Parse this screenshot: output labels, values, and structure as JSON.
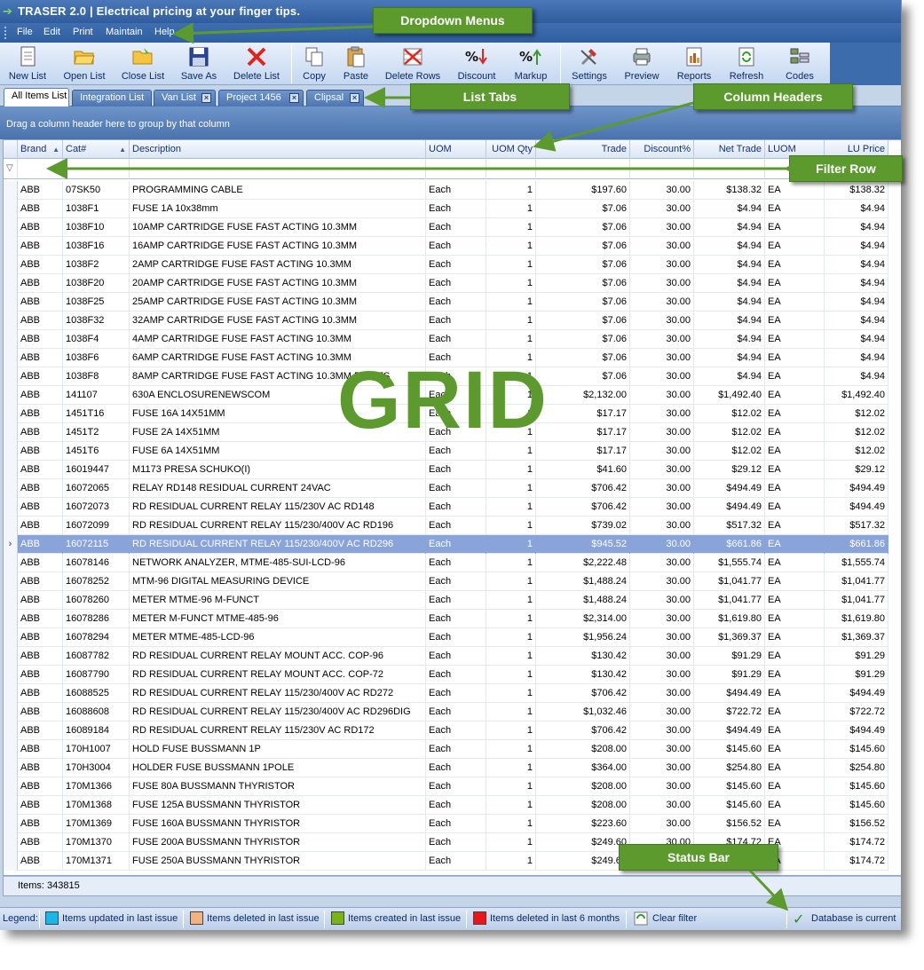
{
  "app": {
    "title": "TRASER 2.0 | Electrical pricing at your finger tips."
  },
  "menu": [
    "File",
    "Edit",
    "Print",
    "Maintain",
    "Help"
  ],
  "toolbar": [
    {
      "label": "New List",
      "icon": "new-list-icon"
    },
    {
      "label": "Open List",
      "icon": "folder-open-icon"
    },
    {
      "label": "Close List",
      "icon": "folder-close-icon"
    },
    {
      "label": "Save As",
      "icon": "floppy-disk-icon"
    },
    {
      "label": "Delete List",
      "icon": "red-x-icon"
    },
    {
      "label": "Copy",
      "icon": "copy-icon"
    },
    {
      "label": "Paste",
      "icon": "paste-icon"
    },
    {
      "label": "Delete Rows",
      "icon": "delete-rows-icon"
    },
    {
      "label": "Discount",
      "icon": "discount-icon"
    },
    {
      "label": "Markup",
      "icon": "markup-icon"
    },
    {
      "label": "Settings",
      "icon": "settings-icon"
    },
    {
      "label": "Preview",
      "icon": "preview-icon"
    },
    {
      "label": "Reports",
      "icon": "reports-icon"
    },
    {
      "label": "Refresh",
      "icon": "refresh-icon"
    },
    {
      "label": "Codes",
      "icon": "codes-icon"
    }
  ],
  "tabs": [
    "All Items List",
    "Integration List",
    "Van List",
    "Project 1456",
    "Clipsal"
  ],
  "group_panel_text": "Drag a column header here to group by that column",
  "columns": [
    "Brand",
    "Cat#",
    "Description",
    "UOM",
    "UOM Qty",
    "Trade",
    "Discount%",
    "Net Trade",
    "LUOM",
    "LU Price"
  ],
  "rows": [
    [
      "ABB",
      "07SK50",
      "PROGRAMMING CABLE",
      "Each",
      "1",
      "$197.60",
      "30.00",
      "$138.32",
      "EA",
      "$138.32"
    ],
    [
      "ABB",
      "1038F1",
      "FUSE 1A 10x38mm",
      "Each",
      "1",
      "$7.06",
      "30.00",
      "$4.94",
      "EA",
      "$4.94"
    ],
    [
      "ABB",
      "1038F10",
      "10AMP CARTRIDGE FUSE FAST ACTING 10.3MM",
      "Each",
      "1",
      "$7.06",
      "30.00",
      "$4.94",
      "EA",
      "$4.94"
    ],
    [
      "ABB",
      "1038F16",
      "16AMP CARTRIDGE FUSE FAST ACTING 10.3MM",
      "Each",
      "1",
      "$7.06",
      "30.00",
      "$4.94",
      "EA",
      "$4.94"
    ],
    [
      "ABB",
      "1038F2",
      "2AMP CARTRIDGE FUSE FAST ACTING 10.3MM",
      "Each",
      "1",
      "$7.06",
      "30.00",
      "$4.94",
      "EA",
      "$4.94"
    ],
    [
      "ABB",
      "1038F20",
      "20AMP CARTRIDGE FUSE FAST ACTING 10.3MM",
      "Each",
      "1",
      "$7.06",
      "30.00",
      "$4.94",
      "EA",
      "$4.94"
    ],
    [
      "ABB",
      "1038F25",
      "25AMP CARTRIDGE FUSE FAST ACTING 10.3MM",
      "Each",
      "1",
      "$7.06",
      "30.00",
      "$4.94",
      "EA",
      "$4.94"
    ],
    [
      "ABB",
      "1038F32",
      "32AMP CARTRIDGE FUSE FAST ACTING 10.3MM",
      "Each",
      "1",
      "$7.06",
      "30.00",
      "$4.94",
      "EA",
      "$4.94"
    ],
    [
      "ABB",
      "1038F4",
      "4AMP CARTRIDGE FUSE FAST ACTING 10.3MM",
      "Each",
      "1",
      "$7.06",
      "30.00",
      "$4.94",
      "EA",
      "$4.94"
    ],
    [
      "ABB",
      "1038F6",
      "6AMP CARTRIDGE FUSE FAST ACTING 10.3MM",
      "Each",
      "1",
      "$7.06",
      "30.00",
      "$4.94",
      "EA",
      "$4.94"
    ],
    [
      "ABB",
      "1038F8",
      "8AMP CARTRIDGE FUSE FAST ACTING 10.3MM FOR FS",
      "Each",
      "1",
      "$7.06",
      "30.00",
      "$4.94",
      "EA",
      "$4.94"
    ],
    [
      "ABB",
      "141107",
      "630A ENCLOSURENEWSCOM",
      "Each",
      "1",
      "$2,132.00",
      "30.00",
      "$1,492.40",
      "EA",
      "$1,492.40"
    ],
    [
      "ABB",
      "1451T16",
      "FUSE 16A 14X51MM",
      "Each",
      "1",
      "$17.17",
      "30.00",
      "$12.02",
      "EA",
      "$12.02"
    ],
    [
      "ABB",
      "1451T2",
      "FUSE 2A 14X51MM",
      "Each",
      "1",
      "$17.17",
      "30.00",
      "$12.02",
      "EA",
      "$12.02"
    ],
    [
      "ABB",
      "1451T6",
      "FUSE 6A 14X51MM",
      "Each",
      "1",
      "$17.17",
      "30.00",
      "$12.02",
      "EA",
      "$12.02"
    ],
    [
      "ABB",
      "16019447",
      "M1173 PRESA SCHUKO(I)",
      "Each",
      "1",
      "$41.60",
      "30.00",
      "$29.12",
      "EA",
      "$29.12"
    ],
    [
      "ABB",
      "16072065",
      "RELAY RD148 RESIDUAL CURRENT 24VAC",
      "Each",
      "1",
      "$706.42",
      "30.00",
      "$494.49",
      "EA",
      "$494.49"
    ],
    [
      "ABB",
      "16072073",
      "RD RESIDUAL CURRENT RELAY 115/230V AC RD148",
      "Each",
      "1",
      "$706.42",
      "30.00",
      "$494.49",
      "EA",
      "$494.49"
    ],
    [
      "ABB",
      "16072099",
      "RD RESIDUAL CURRENT RELAY 115/230/400V AC RD196",
      "Each",
      "1",
      "$739.02",
      "30.00",
      "$517.32",
      "EA",
      "$517.32"
    ],
    [
      "ABB",
      "16072115",
      "RD RESIDUAL CURRENT RELAY 115/230/400V AC RD296",
      "Each",
      "1",
      "$945.52",
      "30.00",
      "$661.86",
      "EA",
      "$661.86"
    ],
    [
      "ABB",
      "16078146",
      "NETWORK ANALYZER, MTME-485-SUI-LCD-96",
      "Each",
      "1",
      "$2,222.48",
      "30.00",
      "$1,555.74",
      "EA",
      "$1,555.74"
    ],
    [
      "ABB",
      "16078252",
      "MTM-96 DIGITAL MEASURING DEVICE",
      "Each",
      "1",
      "$1,488.24",
      "30.00",
      "$1,041.77",
      "EA",
      "$1,041.77"
    ],
    [
      "ABB",
      "16078260",
      "METER MTME-96 M-FUNCT",
      "Each",
      "1",
      "$1,488.24",
      "30.00",
      "$1,041.77",
      "EA",
      "$1,041.77"
    ],
    [
      "ABB",
      "16078286",
      "METER M-FUNCT MTME-485-96",
      "Each",
      "1",
      "$2,314.00",
      "30.00",
      "$1,619.80",
      "EA",
      "$1,619.80"
    ],
    [
      "ABB",
      "16078294",
      "METER MTME-485-LCD-96",
      "Each",
      "1",
      "$1,956.24",
      "30.00",
      "$1,369.37",
      "EA",
      "$1,369.37"
    ],
    [
      "ABB",
      "16087782",
      "RD RESIDUAL CURRENT RELAY MOUNT ACC. COP-96",
      "Each",
      "1",
      "$130.42",
      "30.00",
      "$91.29",
      "EA",
      "$91.29"
    ],
    [
      "ABB",
      "16087790",
      "RD RESIDUAL CURRENT RELAY MOUNT ACC. COP-72",
      "Each",
      "1",
      "$130.42",
      "30.00",
      "$91.29",
      "EA",
      "$91.29"
    ],
    [
      "ABB",
      "16088525",
      "RD RESIDUAL CURRENT RELAY 115/230/400V AC RD272",
      "Each",
      "1",
      "$706.42",
      "30.00",
      "$494.49",
      "EA",
      "$494.49"
    ],
    [
      "ABB",
      "16088608",
      "RD RESIDUAL CURRENT RELAY 115/230/400V AC RD296DIG",
      "Each",
      "1",
      "$1,032.46",
      "30.00",
      "$722.72",
      "EA",
      "$722.72"
    ],
    [
      "ABB",
      "16089184",
      "RD RESIDUAL CURRENT RELAY 115/230V AC RD172",
      "Each",
      "1",
      "$706.42",
      "30.00",
      "$494.49",
      "EA",
      "$494.49"
    ],
    [
      "ABB",
      "170H1007",
      "HOLD FUSE BUSSMANN 1P",
      "Each",
      "1",
      "$208.00",
      "30.00",
      "$145.60",
      "EA",
      "$145.60"
    ],
    [
      "ABB",
      "170H3004",
      "HOLDER FUSE BUSSMANN 1POLE",
      "Each",
      "1",
      "$364.00",
      "30.00",
      "$254.80",
      "EA",
      "$254.80"
    ],
    [
      "ABB",
      "170M1366",
      "FUSE 80A BUSSMANN THYRISTOR",
      "Each",
      "1",
      "$208.00",
      "30.00",
      "$145.60",
      "EA",
      "$145.60"
    ],
    [
      "ABB",
      "170M1368",
      "FUSE 125A BUSSMANN THYRISTOR",
      "Each",
      "1",
      "$208.00",
      "30.00",
      "$145.60",
      "EA",
      "$145.60"
    ],
    [
      "ABB",
      "170M1369",
      "FUSE 160A BUSSMANN THYRISTOR",
      "Each",
      "1",
      "$223.60",
      "30.00",
      "$156.52",
      "EA",
      "$156.52"
    ],
    [
      "ABB",
      "170M1370",
      "FUSE 200A BUSSMANN THYRISTOR",
      "Each",
      "1",
      "$249.60",
      "30.00",
      "$174.72",
      "EA",
      "$174.72"
    ],
    [
      "ABB",
      "170M1371",
      "FUSE 250A BUSSMANN THYRISTOR",
      "Each",
      "1",
      "$249.60",
      "30.00",
      "$174.72",
      "EA",
      "$174.72"
    ]
  ],
  "selected_row": 19,
  "footer": {
    "items_count": "Items: 343815"
  },
  "status": {
    "legend_label": "Legend:",
    "legend": [
      {
        "label": "Items updated in last issue",
        "color": "#19b6e8"
      },
      {
        "label": "Items deleted in last issue",
        "color": "#f3b27f"
      },
      {
        "label": "Items created in last issue",
        "color": "#7ab317"
      },
      {
        "label": "Items deleted in last 6 months",
        "color": "#e8161b"
      }
    ],
    "clear_filter": "Clear filter",
    "db_status": "Database is current"
  },
  "annotations": {
    "dropdown_menus": "Dropdown Menus",
    "list_tabs": "List Tabs",
    "column_headers": "Column Headers",
    "filter_row": "Filter Row",
    "grid": "GRID",
    "status_bar": "Status Bar"
  },
  "colors": {
    "callout": "#5c9a2e",
    "selection": "#8aa3d9",
    "titlebar": "#2e5c9e"
  }
}
